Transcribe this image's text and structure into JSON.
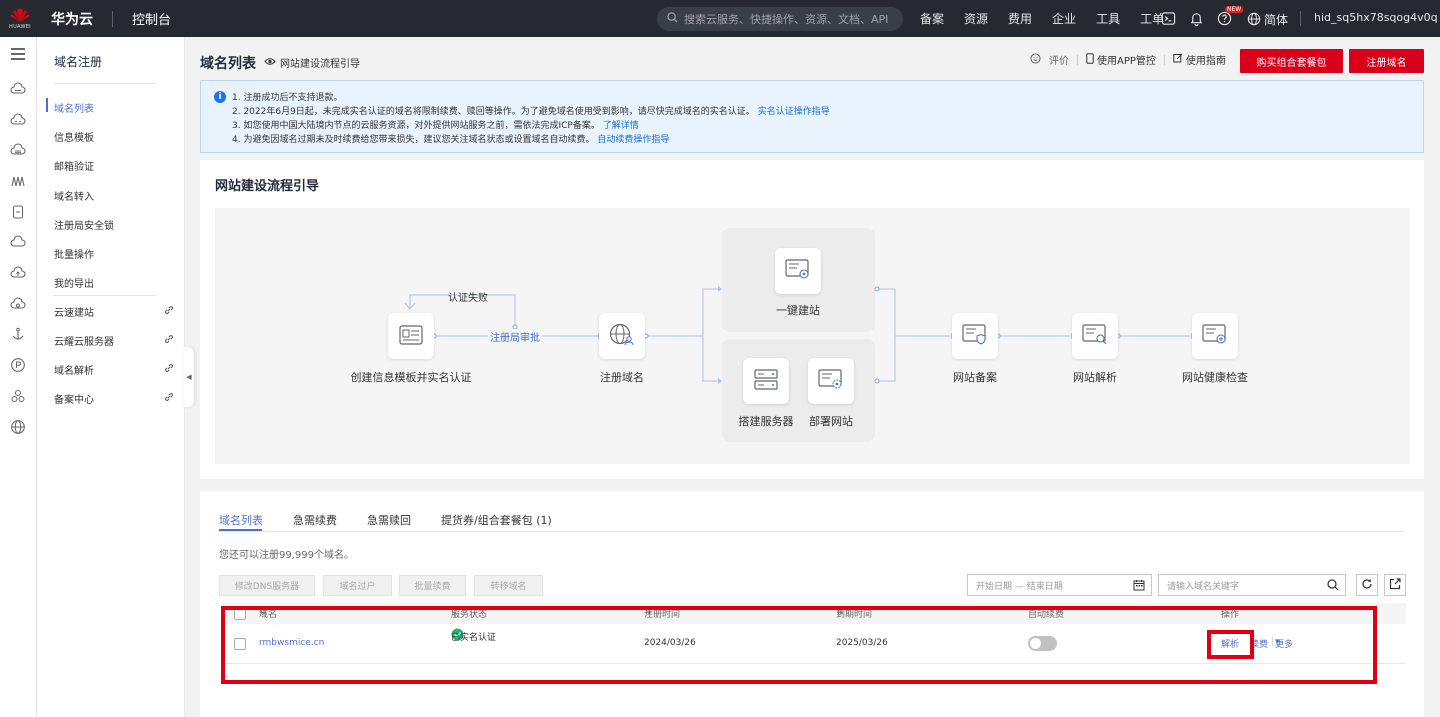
{
  "topbar": {
    "logo_text": "HUAWEI",
    "brand": "华为云",
    "console": "控制台",
    "search_placeholder": "搜索云服务、快捷操作、资源、文档、API",
    "nav": [
      "备案",
      "资源",
      "费用",
      "企业",
      "工具",
      "工单"
    ],
    "new_badge": "NEW",
    "lang": "简体",
    "user": "hid_sq5hx78sqog4v0q"
  },
  "sidenav": {
    "title": "域名注册",
    "items": [
      {
        "label": "域名列表"
      },
      {
        "label": "信息模板"
      },
      {
        "label": "邮箱验证"
      },
      {
        "label": "域名转入"
      },
      {
        "label": "注册局安全锁"
      },
      {
        "label": "批量操作"
      },
      {
        "label": "我的导出"
      }
    ],
    "links": [
      {
        "label": "云速建站"
      },
      {
        "label": "云耀云服务器"
      },
      {
        "label": "域名解析"
      },
      {
        "label": "备案中心"
      }
    ]
  },
  "header": {
    "title": "域名列表",
    "guide": "网站建设流程引导",
    "rate": "评价",
    "app": "使用APP管控",
    "manual": "使用指南",
    "buy_bundle": "购买组合套餐包",
    "register": "注册域名"
  },
  "notice": {
    "lines": [
      {
        "text": "1. 注册成功后不支持退款。",
        "link": ""
      },
      {
        "text": "2. 2022年6月9日起，未完成实名认证的域名将限制续费、赎回等操作。为了避免域名使用受到影响，请尽快完成域名的实名认证。",
        "link": "实名认证操作指导"
      },
      {
        "text": "3. 如您使用中国大陆境内节点的云服务资源，对外提供网站服务之前，需依法完成ICP备案。",
        "link": "了解详情"
      },
      {
        "text": "4. 为避免因域名过期未及时续费给您带来损失，建议您关注域名状态或设置域名自动续费。",
        "link": "自动续费操作指导"
      }
    ]
  },
  "flow": {
    "title": "网站建设流程引导",
    "fail_label": "认证失败",
    "review_label": "注册局审批",
    "nodes": {
      "template": "创建信息模板并实名认证",
      "register": "注册域名",
      "onekey": "一键建站",
      "server": "搭建服务器",
      "deploy": "部署网站",
      "icp": "网站备案",
      "dns": "网站解析",
      "health": "网站健康检查"
    }
  },
  "list": {
    "tabs": [
      "域名列表",
      "急需续费",
      "急需赎回",
      "提货券/组合套餐包 (1)"
    ],
    "quota": "您还可以注册99,999个域名。",
    "actions": [
      "修改DNS服务器",
      "域名过户",
      "批量续费",
      "转移域名"
    ],
    "date_placeholder": "开始日期 — 结束日期",
    "kw_placeholder": "请输入域名关键字",
    "columns": [
      "域名",
      "服务状态",
      "注册时间",
      "到期时间",
      "自动续费",
      "操作"
    ],
    "rows": [
      {
        "domain": "rmbwsmice.cn",
        "status": "已实名认证",
        "registered": "2024/03/26",
        "expires": "2025/03/26",
        "auto_renew": false,
        "op_resolve": "解析",
        "op_renew": "续费",
        "op_more": "更多"
      }
    ]
  },
  "colors": {
    "topbar": "#26292f",
    "brand_red": "#d8001b",
    "link_blue": "#526ecc",
    "highlight_red": "#e00012",
    "status_green": "#22b573"
  }
}
